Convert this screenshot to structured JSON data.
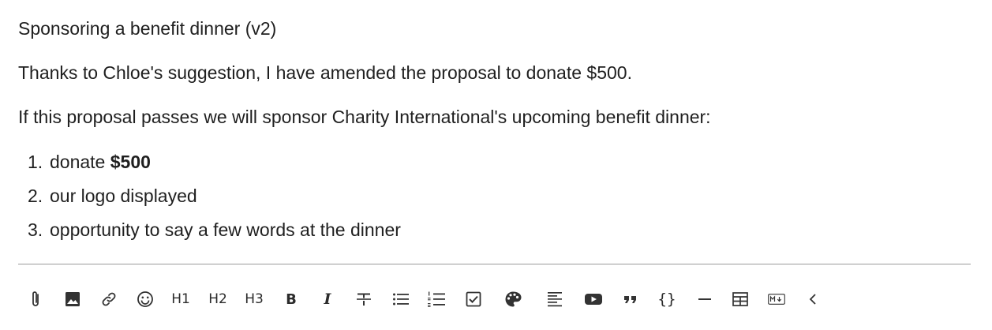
{
  "post": {
    "title": "Sponsoring a benefit dinner (v2)",
    "paragraph1": "Thanks to Chloe's suggestion, I have amended the proposal to donate $500.",
    "paragraph2": "If this proposal passes we will sponsor Charity International's upcoming benefit dinner:",
    "list": [
      {
        "num": "1.",
        "prefix": "donate ",
        "bold": "$500"
      },
      {
        "num": "2.",
        "text": "our logo displayed"
      },
      {
        "num": "3.",
        "text": "opportunity to say a few words at the dinner"
      }
    ]
  },
  "toolbar": {
    "h1": "H1",
    "h2": "H2",
    "h3": "H3",
    "bold": "B",
    "italic": "I",
    "code": "{}",
    "hr": "—"
  },
  "icons": [
    "attachment-icon",
    "image-icon",
    "link-icon",
    "emoji-icon",
    "heading-1-icon",
    "heading-2-icon",
    "heading-3-icon",
    "bold-icon",
    "italic-icon",
    "strikethrough-icon",
    "bullet-list-icon",
    "numbered-list-icon",
    "checklist-icon",
    "color-palette-icon",
    "align-icon",
    "video-icon",
    "quote-icon",
    "code-block-icon",
    "horizontal-rule-icon",
    "table-icon",
    "markdown-icon",
    "collapse-chevron-icon"
  ]
}
